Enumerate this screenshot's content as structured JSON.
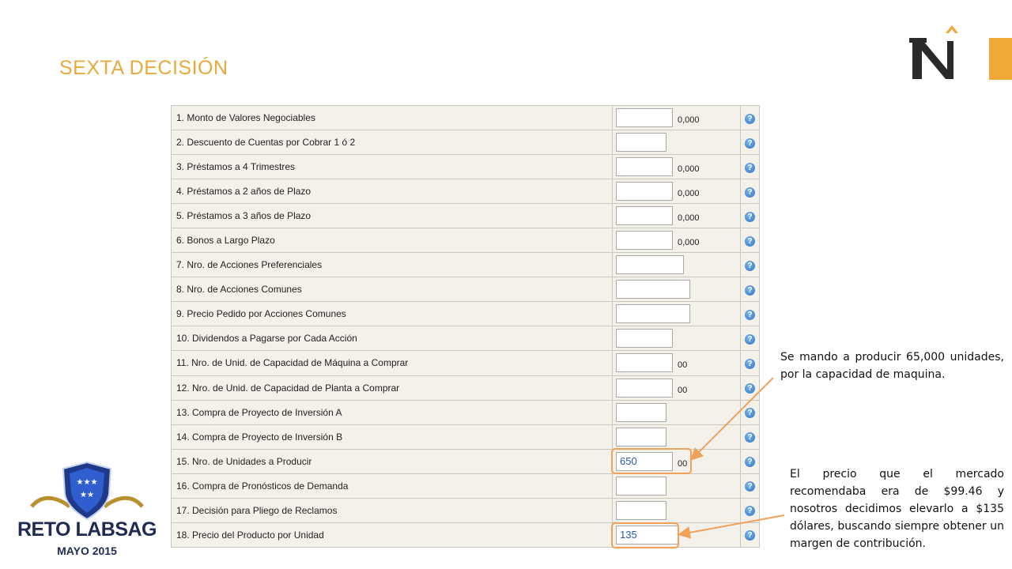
{
  "slide": {
    "title": "SEXTA DECISIÓN"
  },
  "form": {
    "rows": [
      {
        "label": "1. Monto de Valores Negociables",
        "value": "",
        "suffix": "0,000"
      },
      {
        "label": "2. Descuento de Cuentas por Cobrar 1 ó 2",
        "value": "",
        "suffix": ""
      },
      {
        "label": "3. Préstamos a 4 Trimestres",
        "value": "",
        "suffix": "0,000"
      },
      {
        "label": "4. Préstamos a 2 años de Plazo",
        "value": "",
        "suffix": "0,000"
      },
      {
        "label": "5. Préstamos a 3 años de Plazo",
        "value": "",
        "suffix": "0,000"
      },
      {
        "label": "6. Bonos a Largo Plazo",
        "value": "",
        "suffix": "0,000"
      },
      {
        "label": "7. Nro. de Acciones Preferenciales",
        "value": "",
        "suffix": ""
      },
      {
        "label": "8. Nro. de Acciones Comunes",
        "value": "",
        "suffix": ""
      },
      {
        "label": "9. Precio Pedido por Acciones Comunes",
        "value": "",
        "suffix": ""
      },
      {
        "label": "10. Dividendos a Pagarse por Cada Acción",
        "value": "",
        "suffix": ""
      },
      {
        "label": "11. Nro. de Unid. de Capacidad de Máquina a Comprar",
        "value": "",
        "suffix": "00"
      },
      {
        "label": "12. Nro. de Unid. de Capacidad de Planta a Comprar",
        "value": "",
        "suffix": "00"
      },
      {
        "label": "13. Compra de Proyecto de Inversión A",
        "value": "",
        "suffix": ""
      },
      {
        "label": "14. Compra de Proyecto de Inversión B",
        "value": "",
        "suffix": ""
      },
      {
        "label": "15. Nro. de Unidades a Producir",
        "value": "650",
        "suffix": "00"
      },
      {
        "label": "16. Compra de Pronósticos de Demanda",
        "value": "",
        "suffix": ""
      },
      {
        "label": "17. Decisión para Pliego de Reclamos",
        "value": "",
        "suffix": ""
      },
      {
        "label": "18. Precio del Producto por Unidad",
        "value": "135",
        "suffix": ""
      }
    ],
    "help_icon": "help-icon"
  },
  "callouts": {
    "production": "Se mando a producir 65,000 unidades, por la capacidad de maquina.",
    "price": "El precio que el mercado recomendaba era de $99.46 y nosotros decidimos elevarlo a $135 dólares, buscando siempre obtener un margen de contribución."
  },
  "badge": {
    "title": "RETO LABSAG",
    "subtitle": "MAYO 2015"
  },
  "colors": {
    "accent": "#F0A837",
    "title": "#E9A93C",
    "highlight": "#F0A15A",
    "navy": "#1f2b52"
  }
}
